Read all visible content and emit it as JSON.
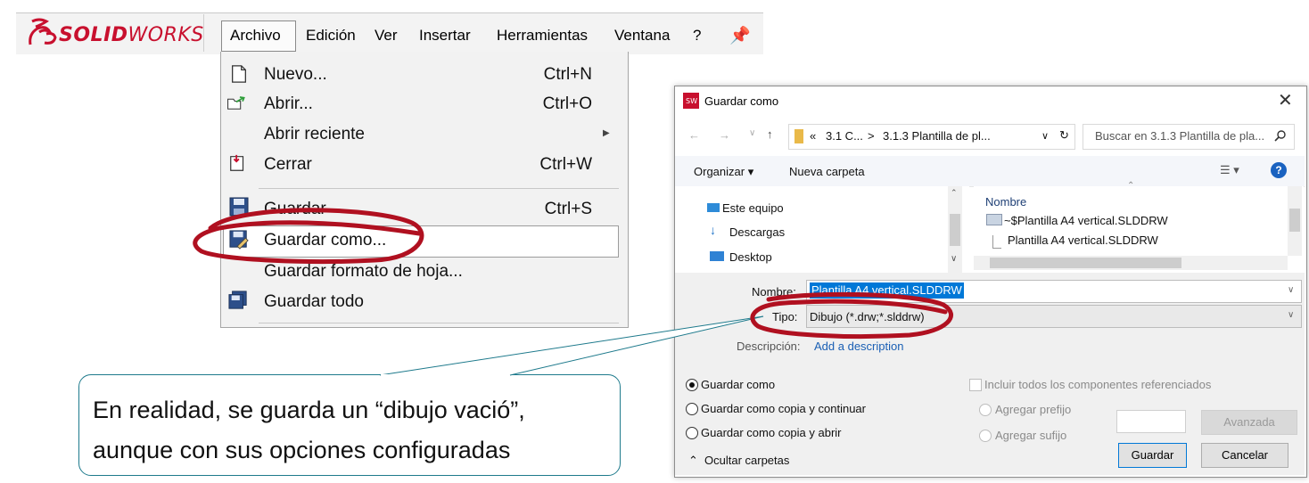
{
  "menubar": {
    "brand": {
      "ds": "3S",
      "solid": "SOLID",
      "works": "WORKS"
    },
    "items": [
      "Archivo",
      "Edición",
      "Ver",
      "Insertar",
      "Herramientas",
      "Ventana",
      "?"
    ]
  },
  "file_menu": {
    "items": [
      {
        "label": "Nuevo...",
        "shortcut": "Ctrl+N"
      },
      {
        "label": "Abrir...",
        "shortcut": "Ctrl+O"
      },
      {
        "label": "Abrir reciente",
        "shortcut": ""
      },
      {
        "label": "Cerrar",
        "shortcut": "Ctrl+W"
      },
      {
        "label": "Guardar",
        "shortcut": "Ctrl+S"
      },
      {
        "label": "Guardar como...",
        "shortcut": ""
      },
      {
        "label": "Guardar formato de hoja...",
        "shortcut": ""
      },
      {
        "label": "Guardar todo",
        "shortcut": ""
      }
    ]
  },
  "dialog": {
    "title": "Guardar como",
    "path": {
      "prefix": "«",
      "seg1": "3.1 C...",
      "sep": ">",
      "seg2": "3.1.3 Plantilla de pl..."
    },
    "search_placeholder": "Buscar en 3.1.3 Plantilla de pla...",
    "toolbar": {
      "organize": "Organizar ▾",
      "new_folder": "Nueva carpeta"
    },
    "nav_items": [
      "Este equipo",
      "Descargas",
      "Desktop"
    ],
    "file_list": {
      "header": "Nombre",
      "files": [
        "~$Plantilla A4 vertical.SLDDRW",
        "Plantilla A4 vertical.SLDDRW"
      ]
    },
    "name_label": "Nombre:",
    "name_value": "Plantilla A4 vertical.SLDDRW",
    "type_label": "Tipo:",
    "type_value": "Dibujo (*.drw;*.slddrw)",
    "desc_label": "Descripción:",
    "desc_link": "Add a description",
    "radios": [
      "Guardar como",
      "Guardar como copia y continuar",
      "Guardar como copia y abrir"
    ],
    "include_refs": "Incluir todos los componentes referenciados",
    "prefix": "Agregar prefijo",
    "suffix": "Agregar sufijo",
    "advanced": "Avanzada",
    "save": "Guardar",
    "cancel": "Cancelar",
    "hide_folders": "Ocultar carpetas"
  },
  "callout": {
    "line1": "En realidad, se guarda un “dibujo vació”,",
    "line2": "aunque con sus opciones configuradas"
  },
  "colors": {
    "brand": "#c8102e",
    "highlight": "#0078d7",
    "annotation": "#b01020",
    "link": "#1a5fb4",
    "callout_border": "#1e7a8c"
  }
}
